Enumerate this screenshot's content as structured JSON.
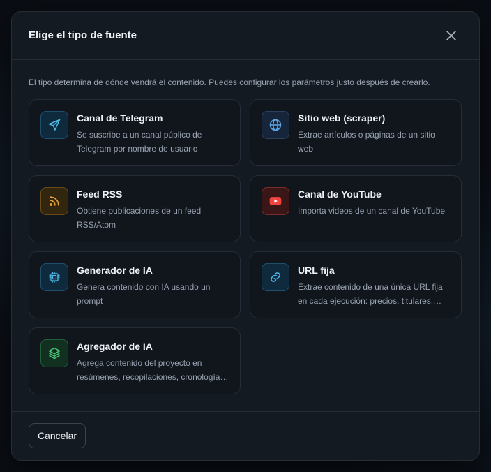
{
  "modal": {
    "title": "Elige el tipo de fuente",
    "description": "El tipo determina de dónde vendrá el contenido. Puedes configurar los parámetros justo después de crearlo.",
    "cancel_label": "Cancelar"
  },
  "sources": [
    {
      "title": "Canal de Telegram",
      "desc": "Se suscribe a un canal público de Telegram por nombre de usuario",
      "icon": "send-icon",
      "color": "#4fb8e8"
    },
    {
      "title": "Sitio web (scraper)",
      "desc": "Extrae artículos o páginas de un sitio web",
      "icon": "globe-icon",
      "color": "#5aa6e8"
    },
    {
      "title": "Feed RSS",
      "desc": "Obtiene publicaciones de un feed RSS/Atom",
      "icon": "rss-icon",
      "color": "#e6a23c"
    },
    {
      "title": "Canal de YouTube",
      "desc": "Importa videos de un canal de YouTube",
      "icon": "youtube-icon",
      "color": "#f0453f"
    },
    {
      "title": "Generador de IA",
      "desc": "Genera contenido con IA usando un prompt",
      "icon": "chip-icon",
      "color": "#4fb8e8"
    },
    {
      "title": "URL fija",
      "desc": "Extrae contenido de una única URL fija en cada ejecución: precios, titulares, datos de tablas",
      "icon": "link-icon",
      "color": "#4fb8e8"
    },
    {
      "title": "Agregador de IA",
      "desc": "Agrega contenido del proyecto en resúmenes, recopilaciones, cronologías y otros formatos",
      "icon": "layers-icon",
      "color": "#4ec67a"
    }
  ]
}
